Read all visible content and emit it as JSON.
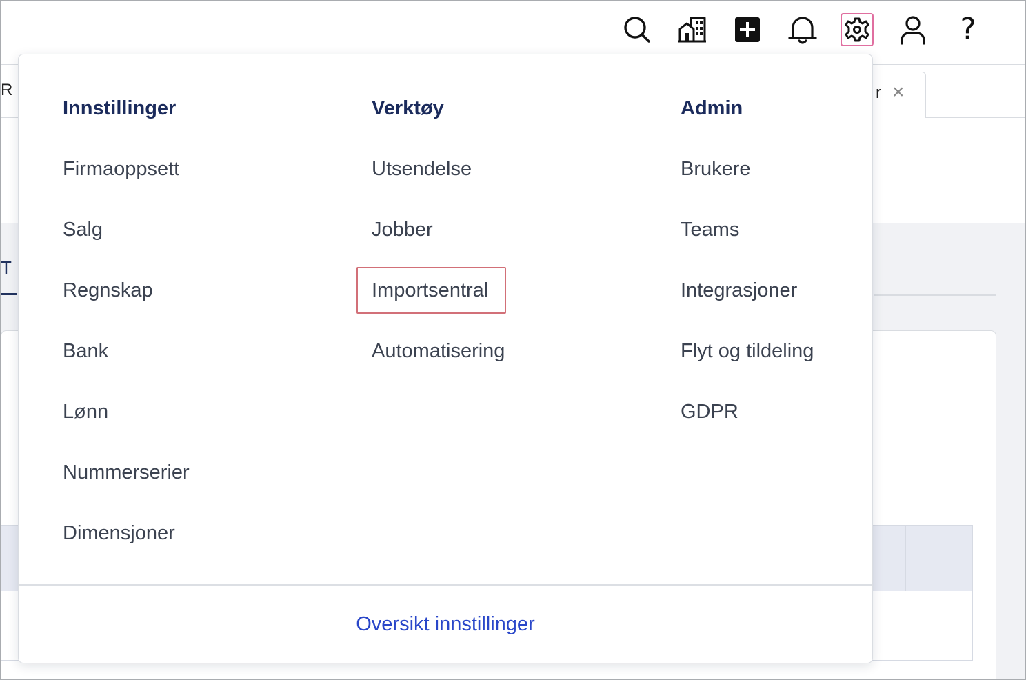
{
  "background": {
    "tab_left_fragment": "R",
    "tab_right_fragment": "r",
    "tab_close_glyph": "×",
    "subnav_fragment": "T"
  },
  "header": {
    "icons": [
      "search-icon",
      "company-buildings-icon",
      "add-icon",
      "notifications-bell-icon",
      "settings-gear-icon",
      "user-profile-icon",
      "help-icon"
    ],
    "active_icon": "settings-gear-icon",
    "help_glyph": "?"
  },
  "settings_menu": {
    "columns": [
      {
        "heading": "Innstillinger",
        "items": [
          "Firmaoppsett",
          "Salg",
          "Regnskap",
          "Bank",
          "Lønn",
          "Nummerserier",
          "Dimensjoner"
        ]
      },
      {
        "heading": "Verktøy",
        "items": [
          "Utsendelse",
          "Jobber",
          "Importsentral",
          "Automatisering"
        ]
      },
      {
        "heading": "Admin",
        "items": [
          "Brukere",
          "Teams",
          "Integrasjoner",
          "Flyt og tildeling",
          "GDPR"
        ]
      }
    ],
    "highlighted_item": "Importsentral",
    "footer_link": "Oversikt innstillinger"
  },
  "colors": {
    "heading": "#1b2b5c",
    "item_text": "#3b4250",
    "link": "#2a47c9",
    "highlight_border": "#d27078",
    "active_icon_border": "#e06fa0"
  }
}
